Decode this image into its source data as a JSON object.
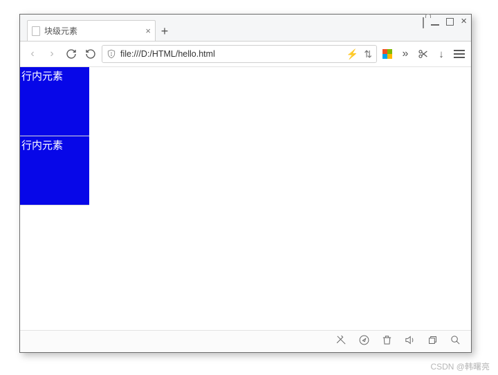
{
  "window": {
    "tab_title": "块级元素",
    "url": "file:///D:/HTML/hello.html"
  },
  "content": {
    "block1_text": "行内元素",
    "block2_text": "行内元素"
  },
  "watermark": "CSDN @韩曙亮"
}
